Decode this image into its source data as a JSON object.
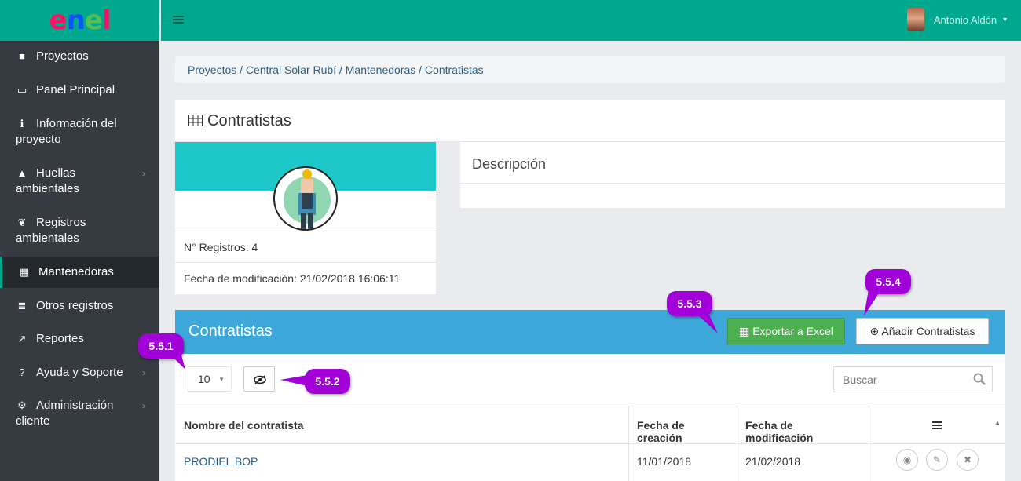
{
  "logo": {
    "letters": [
      "e",
      "n",
      "e",
      "l"
    ],
    "colors": [
      "#ff0f64",
      "#0555fa",
      "#55be5a",
      "#ff0f64"
    ]
  },
  "topbar": {
    "menu_icon": "hamburger-icon",
    "user_name": "Antonio Aldón",
    "dropdown_icon": "caret-down-icon"
  },
  "sidebar": {
    "items": [
      {
        "icon": "dashboard-icon",
        "glyph": "■",
        "label": "Proyectos",
        "label2": ""
      },
      {
        "icon": "monitor-icon",
        "glyph": "▭",
        "label": "Panel Principal",
        "label2": ""
      },
      {
        "icon": "info-icon",
        "glyph": "ℹ",
        "label": "Información del",
        "label2": "proyecto"
      },
      {
        "icon": "tree-icon",
        "glyph": "▲",
        "label": "Huellas",
        "label2": "ambientales",
        "chevron": "›"
      },
      {
        "icon": "leaf-icon",
        "glyph": "❦",
        "label": "Registros",
        "label2": "ambientales"
      },
      {
        "icon": "table-icon",
        "glyph": "▦",
        "label": "Mantenedoras",
        "label2": ""
      },
      {
        "icon": "list-icon",
        "glyph": "≣",
        "label": "Otros registros",
        "label2": ""
      },
      {
        "icon": "chart-icon",
        "glyph": "↗",
        "label": "Reportes",
        "label2": ""
      },
      {
        "icon": "question-icon",
        "glyph": "?",
        "label": "Ayuda y Soporte",
        "label2": "",
        "chevron": "›"
      },
      {
        "icon": "cogs-icon",
        "glyph": "⚙",
        "label": "Administración",
        "label2": "cliente",
        "chevron": "›"
      }
    ]
  },
  "breadcrumb": "Proyectos / Central Solar Rubí / Mantenedoras / Contratistas",
  "panel": {
    "title": "Contratistas",
    "registros": "N° Registros: 4",
    "fecha_mod": "Fecha de modificación: 21/02/2018 16:06:11",
    "descripcion_title": "Descripción"
  },
  "table_section": {
    "title": "Contratistas",
    "export_label": "Exportar a Excel",
    "add_label": "Añadir Contratistas",
    "page_size": "10",
    "search_placeholder": "Buscar",
    "columns": [
      "Nombre del contratista",
      "Fecha de creación",
      "Fecha de modificación"
    ],
    "rows": [
      {
        "nombre": "PRODIEL BOP",
        "creacion": "11/01/2018",
        "modificacion": "21/02/2018"
      }
    ]
  },
  "callouts": {
    "c1": "5.5.1",
    "c2": "5.5.2",
    "c3": "5.5.3",
    "c4": "5.5.4"
  },
  "colors": {
    "brand": "#00a88e",
    "sidebar": "#353b40",
    "header_blue": "#3ea7d9",
    "excel_green": "#4caf50",
    "callout_purple": "#a100d8",
    "card_band": "#1ec8c8"
  }
}
